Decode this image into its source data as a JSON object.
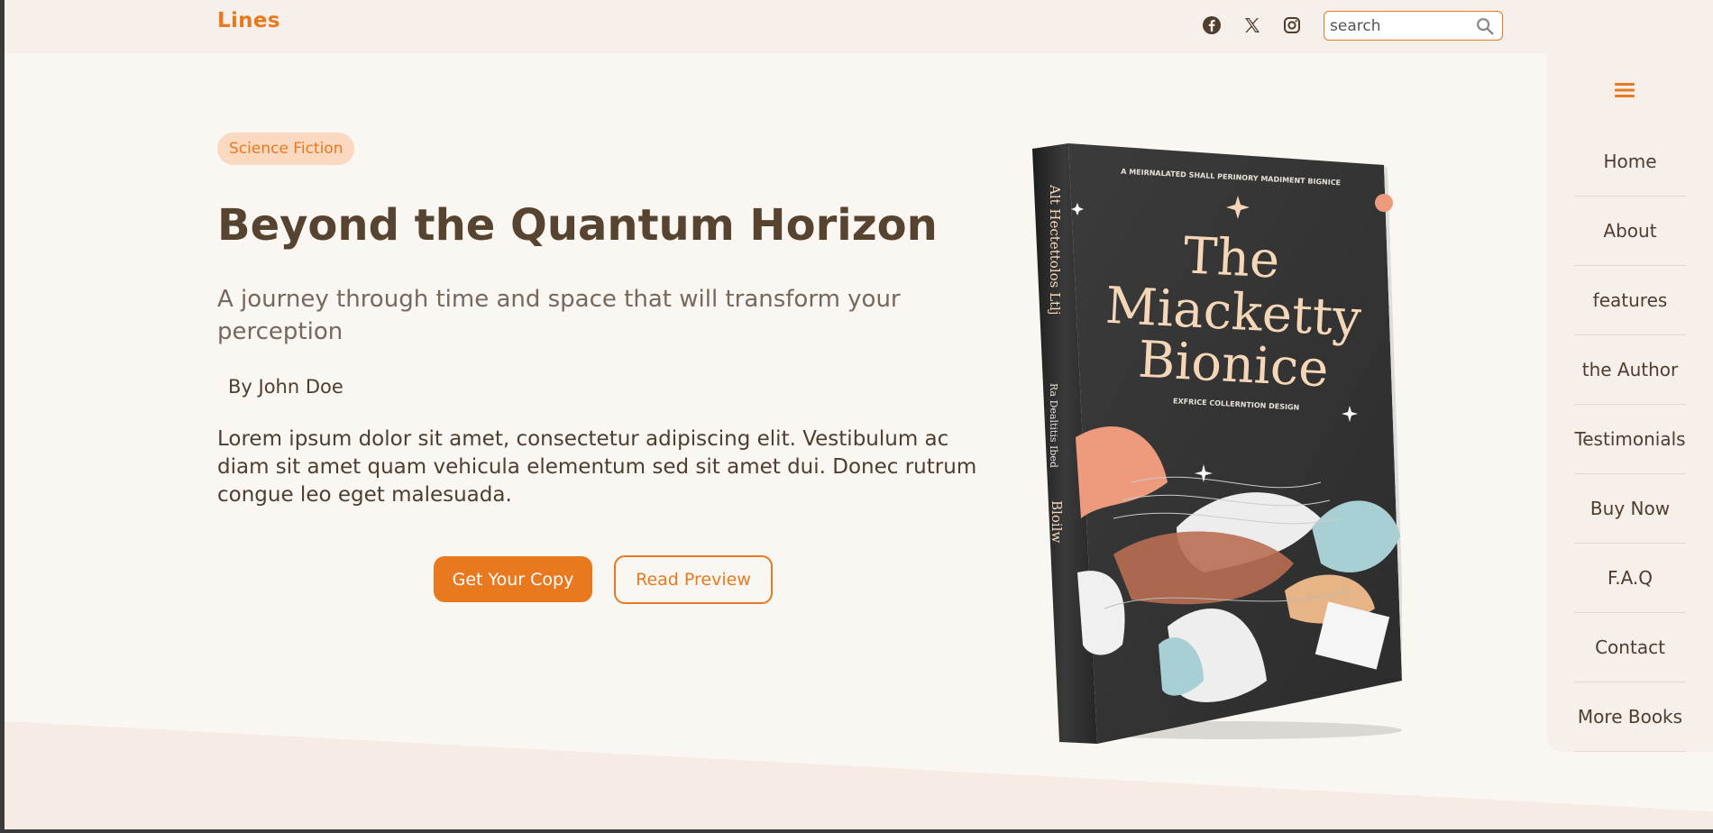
{
  "header": {
    "logo": "Lines",
    "social_icons": [
      "facebook-icon",
      "x-twitter-icon",
      "instagram-icon"
    ],
    "search": {
      "placeholder": "search",
      "value": ""
    }
  },
  "hero": {
    "genre_badge": "Science Fiction",
    "title": "Beyond the Quantum Horizon",
    "subtitle": "A journey through time and space that will transform your perception",
    "author": "By John Doe",
    "description": "Lorem ipsum dolor sit amet, consectetur adipiscing elit. Vestibulum ac diam sit amet quam vehicula elementum sed sit amet dui. Donec rutrum congue leo eget malesuada.",
    "primary_button": "Get Your Copy",
    "secondary_button": "Read Preview"
  },
  "book_cover": {
    "top_line": "A MEIRNALATED SHALL PERINORY MADIMENT BIGNICE",
    "title_line1": "The",
    "title_line2": "Miacketty",
    "title_line3": "Bionice",
    "subtitle": "EXFRICE COLLERNTION DESIGN",
    "spine_text": "Alt Hectettolos Ltlj",
    "spine_sub": "Ra Dealtitis Ibed",
    "spine_bottom": "Bloilw"
  },
  "sidenav": {
    "menu_icon": "hamburger-icon",
    "items": [
      "Home",
      "About",
      "features",
      "the Author",
      "Testimonials",
      "Buy Now",
      "F.A.Q",
      "Contact",
      "More Books"
    ]
  },
  "colors": {
    "accent": "#e8791e",
    "heading": "#574430",
    "text": "#4d3e30",
    "background": "#faf6f2",
    "panel": "#f7efea"
  }
}
